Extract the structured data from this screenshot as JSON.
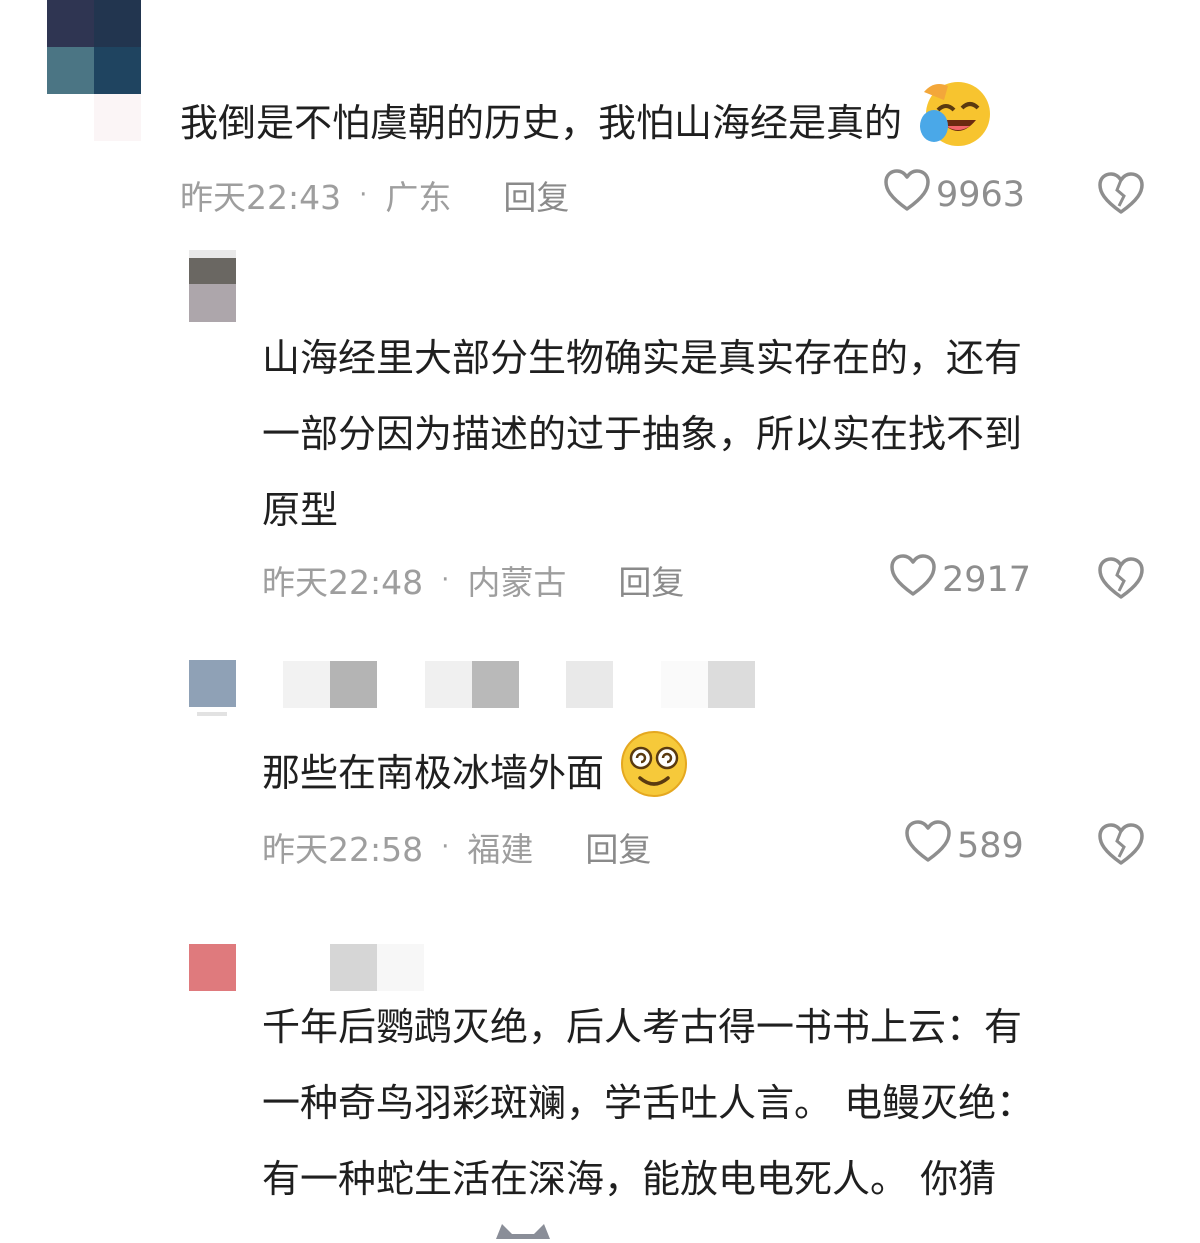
{
  "comments": [
    {
      "text_lines": [
        "我倒是不怕虞朝的历史，我怕山海经是真的"
      ],
      "time": "昨天22:43",
      "location": "广东",
      "reply": "回复",
      "likes": "9963",
      "emoji": "laughing-crying-emoji"
    },
    {
      "text_lines": [
        "山海经里大部分生物确实是真实存在的，还有",
        "一部分因为描述的过于抽象，所以实在找不到",
        "原型"
      ],
      "time": "昨天22:48",
      "location": "内蒙古",
      "reply": "回复",
      "likes": "2917"
    },
    {
      "text_lines": [
        "那些在南极冰墙外面"
      ],
      "time": "昨天22:58",
      "location": "福建",
      "reply": "回复",
      "likes": "589",
      "emoji": "dizzy-smile-emoji"
    },
    {
      "text_lines": [
        "千年后鹦鹉灭绝，后人考古得一书书上云：有",
        "一种奇鸟羽彩斑斓，学舌吐人言。 电鳗灭绝：",
        "有一种蛇生活在深海，能放电电死人。  你猜"
      ]
    }
  ],
  "icons": {
    "like": "heart-outline-icon",
    "dislike": "broken-heart-icon"
  },
  "colors": {
    "text": "#1f1f1f",
    "meta": "#9e9e9e",
    "icon": "#8e8e8e"
  }
}
